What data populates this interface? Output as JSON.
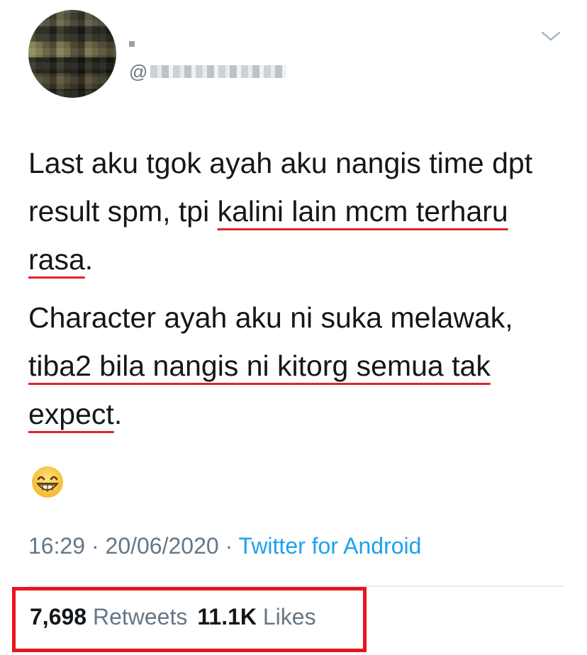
{
  "tweet": {
    "avatar_icon": "blurred-profile-photo",
    "display_name": "",
    "handle_prefix": "@",
    "handle_blurred": true,
    "menu_icon": "chevron-down-icon",
    "paragraphs": [
      [
        {
          "text": "Last aku tgok ayah aku nangis time dpt result spm, tpi ",
          "underline": false
        },
        {
          "text": "kalini lain mcm terharu rasa",
          "underline": true
        },
        {
          "text": ".",
          "underline": false
        }
      ],
      [
        {
          "text": "Character ayah aku ni suka melawak, ",
          "underline": false
        },
        {
          "text": "tiba2 bila nangis ni kitorg semua tak expect",
          "underline": true
        },
        {
          "text": ".",
          "underline": false
        }
      ]
    ],
    "emoji": "grinning-face-with-smiling-eyes",
    "time": "16:29",
    "separator": "·",
    "date": "20/06/2020",
    "source": "Twitter for Android",
    "retweets_count": "7,698",
    "retweets_label": "Retweets",
    "likes_count": "11.1K",
    "likes_label": "Likes"
  },
  "colors": {
    "text": "#14171a",
    "muted": "#657786",
    "link": "#1da1f2",
    "annotation_red": "#e8141e"
  }
}
